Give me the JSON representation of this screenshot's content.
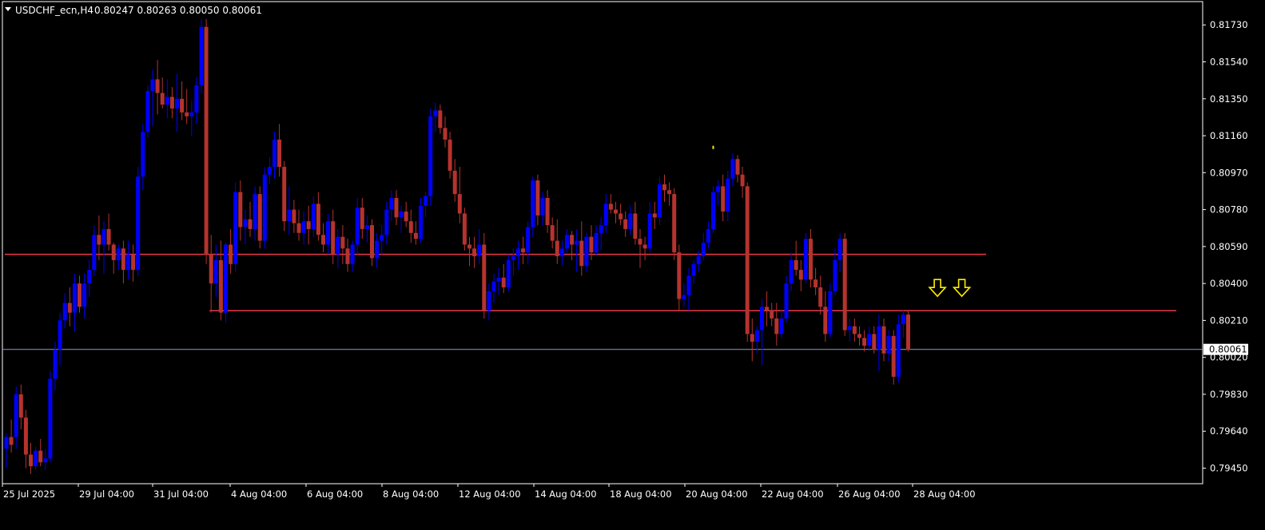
{
  "header": {
    "symbol_timeframe": "USDCHF_ecn,H4",
    "ohlc": "0.80247 0.80263 0.80050 0.80061"
  },
  "colors": {
    "background": "#000000",
    "frame": "#ffffff",
    "bull": "#0000ff",
    "bear": "#b5332e",
    "level_line": "#e8394b",
    "current_price_line": "#8e9dbe",
    "arrow": "#ffee00",
    "text": "#ffffff"
  },
  "chart_data": {
    "type": "candlestick",
    "instrument": "USDCHF_ecn",
    "timeframe": "H4",
    "current_price": "0.80061",
    "y_ticks": [
      "0.81730",
      "0.81540",
      "0.81350",
      "0.81160",
      "0.80970",
      "0.80780",
      "0.80590",
      "0.80400",
      "0.80210",
      "0.80020",
      "0.79830",
      "0.79640",
      "0.79450"
    ],
    "x_ticks": [
      "25 Jul 2025",
      "29 Jul 04:00",
      "31 Jul 04:00",
      "4 Aug 04:00",
      "6 Aug 04:00",
      "8 Aug 04:00",
      "12 Aug 04:00",
      "14 Aug 04:00",
      "18 Aug 04:00",
      "20 Aug 04:00",
      "22 Aug 04:00",
      "26 Aug 04:00",
      "28 Aug 04:00"
    ],
    "ylim": [
      0.7937,
      0.8185
    ],
    "horizontal_levels": [
      {
        "price": 0.8055,
        "from_index": 0,
        "to_index": 201
      },
      {
        "price": 0.8026,
        "from_index": 42,
        "to_index": 240
      }
    ],
    "arrows": [
      {
        "index": 191,
        "price": 0.8033
      },
      {
        "index": 196,
        "price": 0.8033
      }
    ],
    "marker": {
      "index": 145,
      "price": 0.811
    },
    "candles": [
      [
        0.7955,
        0.7963,
        0.7945,
        0.7961
      ],
      [
        0.7961,
        0.797,
        0.7953,
        0.7957
      ],
      [
        0.7961,
        0.7987,
        0.7955,
        0.7983
      ],
      [
        0.7983,
        0.7988,
        0.7965,
        0.7971
      ],
      [
        0.7971,
        0.7975,
        0.7945,
        0.7952
      ],
      [
        0.7952,
        0.7958,
        0.7942,
        0.7946
      ],
      [
        0.7946,
        0.7956,
        0.7944,
        0.7954
      ],
      [
        0.7954,
        0.796,
        0.7946,
        0.7948
      ],
      [
        0.7948,
        0.7955,
        0.7944,
        0.795
      ],
      [
        0.795,
        0.7995,
        0.7948,
        0.7991
      ],
      [
        0.7991,
        0.801,
        0.7985,
        0.8006
      ],
      [
        0.8006,
        0.8025,
        0.7998,
        0.8021
      ],
      [
        0.8021,
        0.8035,
        0.8017,
        0.803
      ],
      [
        0.803,
        0.8038,
        0.8018,
        0.8025
      ],
      [
        0.8025,
        0.8045,
        0.8015,
        0.804
      ],
      [
        0.804,
        0.8044,
        0.8025,
        0.8028
      ],
      [
        0.8028,
        0.8045,
        0.8022,
        0.804
      ],
      [
        0.804,
        0.8052,
        0.8033,
        0.8047
      ],
      [
        0.8047,
        0.807,
        0.8044,
        0.8065
      ],
      [
        0.8065,
        0.8075,
        0.8052,
        0.806
      ],
      [
        0.806,
        0.8072,
        0.8045,
        0.8068
      ],
      [
        0.8068,
        0.8076,
        0.8057,
        0.806
      ],
      [
        0.806,
        0.8061,
        0.8045,
        0.8052
      ],
      [
        0.8052,
        0.806,
        0.8047,
        0.8058
      ],
      [
        0.8058,
        0.8062,
        0.804,
        0.8047
      ],
      [
        0.8047,
        0.8062,
        0.8042,
        0.8055
      ],
      [
        0.8055,
        0.806,
        0.8041,
        0.8047
      ],
      [
        0.8047,
        0.81,
        0.8044,
        0.8095
      ],
      [
        0.8095,
        0.8122,
        0.8088,
        0.8118
      ],
      [
        0.8118,
        0.8142,
        0.8115,
        0.8139
      ],
      [
        0.8139,
        0.815,
        0.8121,
        0.8145
      ],
      [
        0.8145,
        0.8155,
        0.8127,
        0.8138
      ],
      [
        0.8138,
        0.8146,
        0.813,
        0.8132
      ],
      [
        0.8132,
        0.8145,
        0.8125,
        0.8136
      ],
      [
        0.8136,
        0.8141,
        0.8125,
        0.813
      ],
      [
        0.813,
        0.8148,
        0.8118,
        0.8135
      ],
      [
        0.8135,
        0.8144,
        0.8124,
        0.8128
      ],
      [
        0.8128,
        0.814,
        0.8122,
        0.8126
      ],
      [
        0.8126,
        0.8134,
        0.8116,
        0.8128
      ],
      [
        0.8128,
        0.8146,
        0.8122,
        0.8142
      ],
      [
        0.8142,
        0.8176,
        0.8138,
        0.8172
      ],
      [
        0.8172,
        0.8176,
        0.805,
        0.8055
      ],
      [
        0.8055,
        0.8065,
        0.8025,
        0.804
      ],
      [
        0.804,
        0.806,
        0.8033,
        0.8052
      ],
      [
        0.8052,
        0.8062,
        0.8021,
        0.8025
      ],
      [
        0.8025,
        0.8061,
        0.802,
        0.806
      ],
      [
        0.806,
        0.8068,
        0.8045,
        0.805
      ],
      [
        0.805,
        0.8092,
        0.8046,
        0.8087
      ],
      [
        0.8087,
        0.8093,
        0.8062,
        0.8069
      ],
      [
        0.8069,
        0.8078,
        0.806,
        0.8073
      ],
      [
        0.8073,
        0.8082,
        0.8064,
        0.8068
      ],
      [
        0.8068,
        0.809,
        0.8062,
        0.8086
      ],
      [
        0.8086,
        0.809,
        0.8058,
        0.8062
      ],
      [
        0.8062,
        0.81,
        0.8058,
        0.8096
      ],
      [
        0.8096,
        0.8105,
        0.8091,
        0.81
      ],
      [
        0.81,
        0.8118,
        0.8094,
        0.8114
      ],
      [
        0.8114,
        0.8122,
        0.8095,
        0.81
      ],
      [
        0.81,
        0.8103,
        0.8067,
        0.8072
      ],
      [
        0.8072,
        0.809,
        0.8065,
        0.8078
      ],
      [
        0.8078,
        0.8083,
        0.8066,
        0.8071
      ],
      [
        0.8071,
        0.8078,
        0.8062,
        0.8066
      ],
      [
        0.8066,
        0.8077,
        0.806,
        0.8072
      ],
      [
        0.8072,
        0.808,
        0.806,
        0.8068
      ],
      [
        0.8068,
        0.8085,
        0.8064,
        0.8081
      ],
      [
        0.8081,
        0.8087,
        0.8062,
        0.8065
      ],
      [
        0.8065,
        0.8071,
        0.8056,
        0.806
      ],
      [
        0.806,
        0.8076,
        0.8055,
        0.8072
      ],
      [
        0.8072,
        0.8078,
        0.805,
        0.8055
      ],
      [
        0.8055,
        0.8068,
        0.8048,
        0.8064
      ],
      [
        0.8064,
        0.807,
        0.805,
        0.8058
      ],
      [
        0.8058,
        0.8063,
        0.8046,
        0.805
      ],
      [
        0.805,
        0.8062,
        0.8046,
        0.806
      ],
      [
        0.806,
        0.8084,
        0.8055,
        0.8079
      ],
      [
        0.8079,
        0.8084,
        0.8063,
        0.8068
      ],
      [
        0.8068,
        0.8075,
        0.8061,
        0.807
      ],
      [
        0.807,
        0.8073,
        0.8049,
        0.8053
      ],
      [
        0.8053,
        0.8066,
        0.8048,
        0.8062
      ],
      [
        0.8062,
        0.807,
        0.8055,
        0.8065
      ],
      [
        0.8065,
        0.8082,
        0.806,
        0.8078
      ],
      [
        0.8078,
        0.8088,
        0.8072,
        0.8084
      ],
      [
        0.8084,
        0.8088,
        0.807,
        0.8074
      ],
      [
        0.8074,
        0.808,
        0.8066,
        0.8077
      ],
      [
        0.8077,
        0.8082,
        0.8069,
        0.8072
      ],
      [
        0.8072,
        0.8078,
        0.8061,
        0.8066
      ],
      [
        0.8066,
        0.8072,
        0.806,
        0.8063
      ],
      [
        0.8063,
        0.8084,
        0.8061,
        0.808
      ],
      [
        0.808,
        0.8087,
        0.8074,
        0.8085
      ],
      [
        0.8085,
        0.813,
        0.808,
        0.8126
      ],
      [
        0.8126,
        0.8133,
        0.8118,
        0.8129
      ],
      [
        0.8129,
        0.8132,
        0.8117,
        0.812
      ],
      [
        0.812,
        0.8126,
        0.811,
        0.8114
      ],
      [
        0.8114,
        0.8118,
        0.8094,
        0.8098
      ],
      [
        0.8098,
        0.8104,
        0.8082,
        0.8086
      ],
      [
        0.8086,
        0.81,
        0.8071,
        0.8076
      ],
      [
        0.8076,
        0.8079,
        0.8057,
        0.806
      ],
      [
        0.806,
        0.8064,
        0.8049,
        0.8058
      ],
      [
        0.8058,
        0.8064,
        0.8048,
        0.8054
      ],
      [
        0.8054,
        0.8068,
        0.805,
        0.806
      ],
      [
        0.806,
        0.8066,
        0.8022,
        0.8026
      ],
      [
        0.8026,
        0.804,
        0.8021,
        0.8036
      ],
      [
        0.8036,
        0.8045,
        0.803,
        0.8041
      ],
      [
        0.8041,
        0.8048,
        0.8034,
        0.8043
      ],
      [
        0.8043,
        0.805,
        0.8035,
        0.8038
      ],
      [
        0.8038,
        0.8055,
        0.8036,
        0.8052
      ],
      [
        0.8052,
        0.8058,
        0.8044,
        0.8054
      ],
      [
        0.8054,
        0.8062,
        0.8047,
        0.8058
      ],
      [
        0.8058,
        0.8064,
        0.805,
        0.8056
      ],
      [
        0.8056,
        0.8072,
        0.805,
        0.8069
      ],
      [
        0.8069,
        0.8095,
        0.8064,
        0.8093
      ],
      [
        0.8093,
        0.8096,
        0.807,
        0.8075
      ],
      [
        0.8075,
        0.8087,
        0.807,
        0.8084
      ],
      [
        0.8084,
        0.8088,
        0.8066,
        0.807
      ],
      [
        0.807,
        0.8074,
        0.8058,
        0.8062
      ],
      [
        0.8062,
        0.8073,
        0.805,
        0.8054
      ],
      [
        0.8054,
        0.8062,
        0.8049,
        0.8058
      ],
      [
        0.8058,
        0.8068,
        0.8056,
        0.8065
      ],
      [
        0.8065,
        0.8067,
        0.8052,
        0.806
      ],
      [
        0.806,
        0.8068,
        0.8046,
        0.8062
      ],
      [
        0.8062,
        0.8072,
        0.8044,
        0.8049
      ],
      [
        0.8049,
        0.8066,
        0.8046,
        0.8064
      ],
      [
        0.8064,
        0.807,
        0.8052,
        0.8056
      ],
      [
        0.8056,
        0.807,
        0.8054,
        0.8066
      ],
      [
        0.8066,
        0.8074,
        0.8057,
        0.807
      ],
      [
        0.807,
        0.8086,
        0.8066,
        0.8081
      ],
      [
        0.8081,
        0.8086,
        0.8076,
        0.8078
      ],
      [
        0.8078,
        0.8082,
        0.8071,
        0.8076
      ],
      [
        0.8076,
        0.8081,
        0.807,
        0.8073
      ],
      [
        0.8073,
        0.8077,
        0.8064,
        0.8068
      ],
      [
        0.8068,
        0.808,
        0.8065,
        0.8076
      ],
      [
        0.8076,
        0.8082,
        0.806,
        0.8063
      ],
      [
        0.8063,
        0.8068,
        0.8048,
        0.806
      ],
      [
        0.806,
        0.8064,
        0.8052,
        0.8058
      ],
      [
        0.8058,
        0.8082,
        0.8056,
        0.8076
      ],
      [
        0.8076,
        0.8082,
        0.8068,
        0.8074
      ],
      [
        0.8074,
        0.8095,
        0.807,
        0.8091
      ],
      [
        0.8091,
        0.8096,
        0.8082,
        0.8088
      ],
      [
        0.8088,
        0.8092,
        0.808,
        0.8086
      ],
      [
        0.8086,
        0.8089,
        0.8052,
        0.8056
      ],
      [
        0.8056,
        0.806,
        0.8026,
        0.8032
      ],
      [
        0.8032,
        0.804,
        0.8028,
        0.8034
      ],
      [
        0.8034,
        0.8048,
        0.8026,
        0.8044
      ],
      [
        0.8044,
        0.8052,
        0.804,
        0.805
      ],
      [
        0.805,
        0.8057,
        0.8046,
        0.8054
      ],
      [
        0.8054,
        0.8066,
        0.8052,
        0.8061
      ],
      [
        0.8061,
        0.8072,
        0.8058,
        0.8068
      ],
      [
        0.8068,
        0.809,
        0.8066,
        0.8087
      ],
      [
        0.8087,
        0.8093,
        0.808,
        0.809
      ],
      [
        0.809,
        0.8096,
        0.8072,
        0.8077
      ],
      [
        0.8077,
        0.8098,
        0.8072,
        0.8094
      ],
      [
        0.8094,
        0.8107,
        0.809,
        0.8104
      ],
      [
        0.8104,
        0.8106,
        0.8092,
        0.8096
      ],
      [
        0.8096,
        0.81,
        0.8084,
        0.809
      ],
      [
        0.809,
        0.8092,
        0.801,
        0.8014
      ],
      [
        0.8014,
        0.8022,
        0.8,
        0.801
      ],
      [
        0.801,
        0.8018,
        0.8004,
        0.8016
      ],
      [
        0.8016,
        0.8032,
        0.7998,
        0.8028
      ],
      [
        0.8028,
        0.8036,
        0.8018,
        0.8026
      ],
      [
        0.8026,
        0.803,
        0.8018,
        0.8022
      ],
      [
        0.8022,
        0.803,
        0.8008,
        0.8014
      ],
      [
        0.8014,
        0.8026,
        0.8012,
        0.8022
      ],
      [
        0.8022,
        0.8044,
        0.802,
        0.804
      ],
      [
        0.804,
        0.8056,
        0.8036,
        0.8052
      ],
      [
        0.8052,
        0.8062,
        0.8044,
        0.8047
      ],
      [
        0.8047,
        0.8052,
        0.8036,
        0.8042
      ],
      [
        0.8042,
        0.8066,
        0.804,
        0.8063
      ],
      [
        0.8063,
        0.8068,
        0.8038,
        0.8042
      ],
      [
        0.8042,
        0.8048,
        0.8034,
        0.8038
      ],
      [
        0.8038,
        0.8044,
        0.8024,
        0.8028
      ],
      [
        0.8028,
        0.8036,
        0.801,
        0.8014
      ],
      [
        0.8014,
        0.804,
        0.8012,
        0.8036
      ],
      [
        0.8036,
        0.8058,
        0.8034,
        0.8052
      ],
      [
        0.8052,
        0.8066,
        0.8046,
        0.8063
      ],
      [
        0.8063,
        0.8066,
        0.8013,
        0.8016
      ],
      [
        0.8016,
        0.8022,
        0.801,
        0.8018
      ],
      [
        0.8018,
        0.8022,
        0.801,
        0.8014
      ],
      [
        0.8014,
        0.8018,
        0.8008,
        0.8012
      ],
      [
        0.8012,
        0.8016,
        0.8005,
        0.8008
      ],
      [
        0.8008,
        0.8018,
        0.8006,
        0.8014
      ],
      [
        0.8014,
        0.8018,
        0.8004,
        0.8006
      ],
      [
        0.8006,
        0.8024,
        0.7995,
        0.8018
      ],
      [
        0.8018,
        0.8022,
        0.8,
        0.8004
      ],
      [
        0.8004,
        0.8016,
        0.8,
        0.8013
      ],
      [
        0.8013,
        0.8016,
        0.7988,
        0.7992
      ],
      [
        0.7992,
        0.8024,
        0.7989,
        0.8019
      ],
      [
        0.8019,
        0.8026,
        0.8012,
        0.8024
      ],
      [
        0.8024,
        0.8026,
        0.8005,
        0.8006
      ]
    ]
  }
}
